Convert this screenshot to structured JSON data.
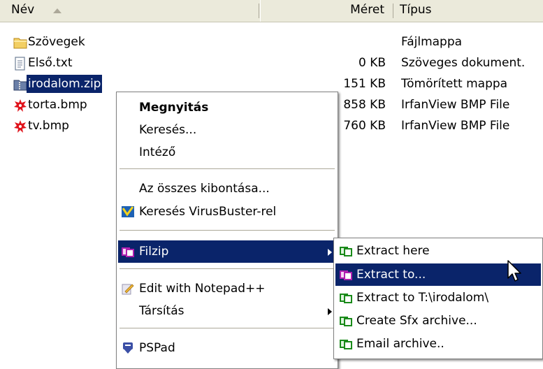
{
  "header": {
    "name": "Név",
    "size": "Méret",
    "type": "Típus"
  },
  "files": [
    {
      "name": "Szövegek",
      "size": "",
      "type": "Fájlmappa",
      "icon": "folder-icon"
    },
    {
      "name": "Első.txt",
      "size": "0 KB",
      "type": "Szöveges dokument.",
      "icon": "text-file-icon"
    },
    {
      "name": "irodalom.zip",
      "size": "151 KB",
      "type": "Tömörített mappa",
      "icon": "zip-folder-icon"
    },
    {
      "name": "torta.bmp",
      "size": "858 KB",
      "type": "IrfanView BMP File",
      "icon": "irfanview-icon"
    },
    {
      "name": "tv.bmp",
      "size": "760 KB",
      "type": "IrfanView BMP File",
      "icon": "irfanview-icon"
    }
  ],
  "context_menu": {
    "open": "Megnyitás",
    "search": "Keresés...",
    "explorer": "Intéző",
    "extract_all": "Az összes kibontása...",
    "virusbuster": "Keresés VirusBuster-rel",
    "filzip": "Filzip",
    "notepadpp": "Edit with Notepad++",
    "open_with": "Társítás",
    "pspad": "PSPad"
  },
  "filzip_submenu": {
    "extract_here": "Extract here",
    "extract_to": "Extract to...",
    "extract_to_folder": "Extract to T:\\irodalom\\",
    "create_sfx": "Create Sfx archive...",
    "email_archive": "Email archive.."
  },
  "colors": {
    "selection": "#0a246a",
    "header_bg": "#ebeadb",
    "filzip_green": "#1a8a1a",
    "filzip_pink": "#b01fb0"
  }
}
